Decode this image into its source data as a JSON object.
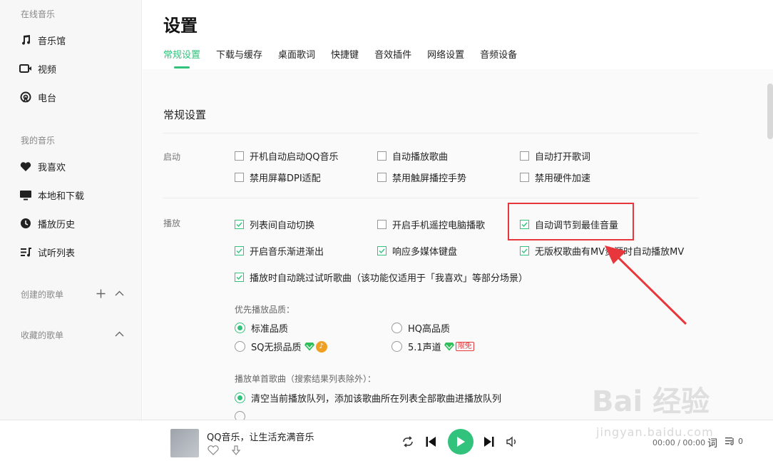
{
  "sidebar": {
    "online_group": "在线音乐",
    "online_items": [
      {
        "label": "音乐馆",
        "icon": "music-note-icon"
      },
      {
        "label": "视频",
        "icon": "video-icon"
      },
      {
        "label": "电台",
        "icon": "radio-icon"
      }
    ],
    "my_group": "我的音乐",
    "my_items": [
      {
        "label": "我喜欢",
        "icon": "heart-icon"
      },
      {
        "label": "本地和下载",
        "icon": "monitor-icon"
      },
      {
        "label": "播放历史",
        "icon": "clock-icon"
      },
      {
        "label": "试听列表",
        "icon": "playlist-icon"
      }
    ],
    "created_playlists": "创建的歌单",
    "collected_playlists": "收藏的歌单"
  },
  "header": {
    "title": "设置",
    "tabs": [
      "常规设置",
      "下载与缓存",
      "桌面歌词",
      "快捷键",
      "音效插件",
      "网络设置",
      "音频设备"
    ],
    "active_tab": "常规设置"
  },
  "general": {
    "section_title": "常规设置",
    "startup_label": "启动",
    "startup_options": [
      {
        "label": "开机自动启动QQ音乐",
        "checked": false
      },
      {
        "label": "自动播放歌曲",
        "checked": false
      },
      {
        "label": "自动打开歌词",
        "checked": false
      },
      {
        "label": "禁用屏幕DPI适配",
        "checked": false
      },
      {
        "label": "禁用触屏播控手势",
        "checked": false
      },
      {
        "label": "禁用硬件加速",
        "checked": false
      }
    ],
    "playback_label": "播放",
    "playback_options": [
      {
        "label": "列表间自动切换",
        "checked": true
      },
      {
        "label": "开启手机遥控电脑播歌",
        "checked": false
      },
      {
        "label": "自动调节到最佳音量",
        "checked": true
      },
      {
        "label": "开启音乐渐进渐出",
        "checked": true
      },
      {
        "label": "响应多媒体键盘",
        "checked": true
      },
      {
        "label": "无版权歌曲有MV资源时自动播放MV",
        "checked": true
      },
      {
        "label": "播放时自动跳过试听歌曲（该功能仅适用于「我喜欢」等部分场景）",
        "checked": true
      }
    ],
    "quality_label": "优先播放品质：",
    "quality_options": [
      {
        "label": "标准品质",
        "checked": true
      },
      {
        "label": "HQ高品质",
        "checked": false
      },
      {
        "label": "SQ无损品质",
        "checked": false
      },
      {
        "label": "5.1声道",
        "checked": false
      }
    ],
    "limited_badge": "限免",
    "single_play_label": "播放单首歌曲（搜索结果列表除外）：",
    "single_play_options": [
      {
        "label": "清空当前播放队列，添加该歌曲所在列表全部歌曲进播放队列",
        "checked": true
      }
    ]
  },
  "player": {
    "song_title": "QQ音乐，让生活充满音乐",
    "time": "00:00 / 00:00",
    "lyric_button": "词",
    "queue_count": "0"
  },
  "colors": {
    "accent": "#31c27c",
    "highlight": "#e8373c"
  },
  "watermark": {
    "brand": "Bai 经验",
    "url": "jingyan.baidu.com"
  }
}
